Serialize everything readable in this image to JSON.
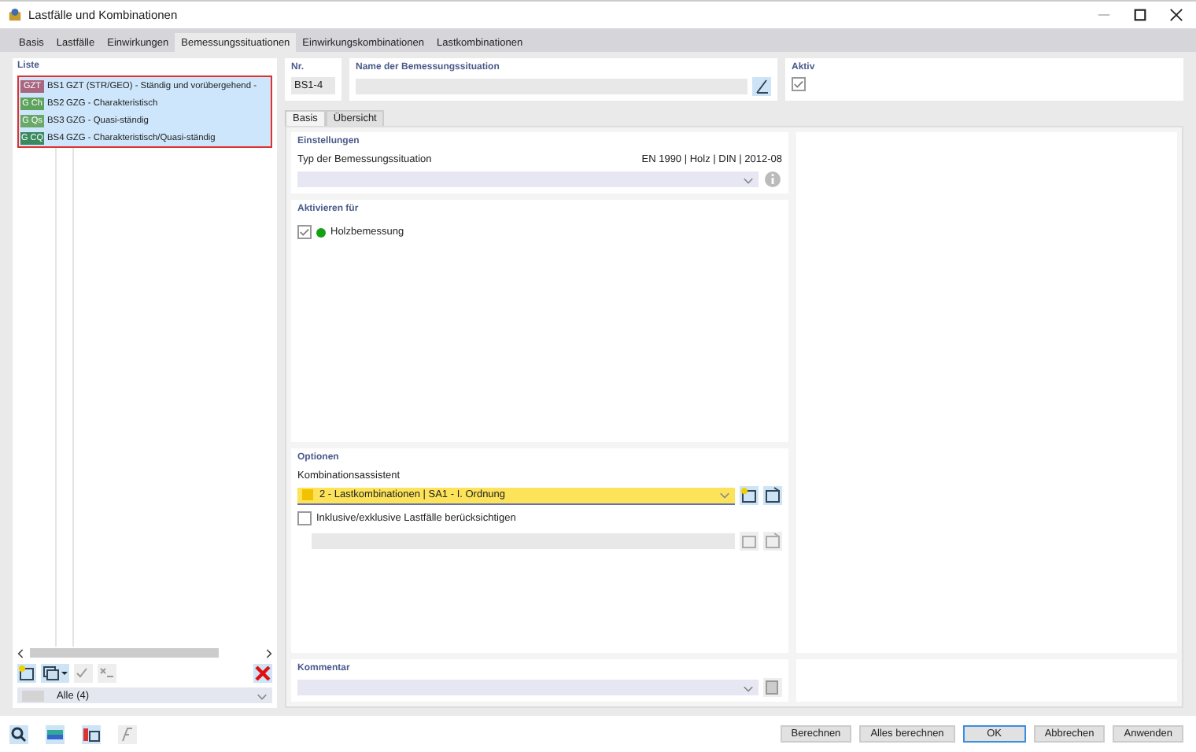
{
  "window": {
    "title": "Lastfälle und Kombinationen"
  },
  "tabs": [
    {
      "label": "Basis",
      "selected": false
    },
    {
      "label": "Lastfälle",
      "selected": false
    },
    {
      "label": "Einwirkungen",
      "selected": false
    },
    {
      "label": "Bemessungssituationen",
      "selected": true
    },
    {
      "label": "Einwirkungskombinationen",
      "selected": false
    },
    {
      "label": "Lastkombinationen",
      "selected": false
    }
  ],
  "list": {
    "title": "Liste",
    "items": [
      {
        "badge": "GZT",
        "color": "#a8677f",
        "code": "BS1",
        "text": "GZT (STR/GEO) - Ständig und vorübergehend -",
        "selected": true
      },
      {
        "badge": "G Ch",
        "color": "#5da35d",
        "code": "BS2",
        "text": "GZG - Charakteristisch",
        "selected": true
      },
      {
        "badge": "G Qs",
        "color": "#6aa86a",
        "code": "BS3",
        "text": "GZG - Quasi-ständig",
        "selected": true
      },
      {
        "badge": "G CQ",
        "color": "#3b8a5e",
        "code": "BS4",
        "text": "GZG - Charakteristisch/Quasi-ständig",
        "selected": true
      }
    ],
    "filter": "Alle (4)"
  },
  "nr": {
    "label": "Nr.",
    "value": "BS1-4"
  },
  "name": {
    "label": "Name der Bemessungssituation"
  },
  "aktiv": {
    "label": "Aktiv",
    "checked": true
  },
  "subtabs": [
    {
      "label": "Basis",
      "selected": true
    },
    {
      "label": "Übersicht",
      "selected": false
    }
  ],
  "einstellungen": {
    "title": "Einstellungen",
    "type_label": "Typ der Bemessungssituation",
    "norm": "EN 1990 | Holz | DIN | 2012-08"
  },
  "aktivieren": {
    "title": "Aktivieren für",
    "items": [
      {
        "label": "Holzbemessung",
        "checked": true,
        "color": "#14a014"
      }
    ]
  },
  "optionen": {
    "title": "Optionen",
    "assistant_label": "Kombinationsassistent",
    "assistant": {
      "value": "2 - Lastkombinationen | SA1 - I. Ordnung",
      "color": "#f2c200"
    },
    "inclusive": {
      "label": "Inklusive/exklusive Lastfälle berücksichtigen",
      "checked": false
    }
  },
  "kommentar": {
    "title": "Kommentar"
  },
  "buttons": [
    {
      "label": "Berechnen",
      "default": false
    },
    {
      "label": "Alles berechnen",
      "default": false
    },
    {
      "label": "OK",
      "default": true
    },
    {
      "label": "Abbrechen",
      "default": false
    },
    {
      "label": "Anwenden",
      "default": false
    }
  ]
}
